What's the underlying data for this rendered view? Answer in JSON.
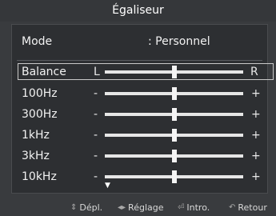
{
  "title": "Égaliseur",
  "mode": {
    "label": "Mode",
    "value": ": Personnel"
  },
  "balance": {
    "label": "Balance",
    "left": "L",
    "right": "R",
    "level": 0.5
  },
  "bands": [
    {
      "label": "100Hz",
      "minus": "-",
      "plus": "+",
      "level": 0.5
    },
    {
      "label": "300Hz",
      "minus": "-",
      "plus": "+",
      "level": 0.5
    },
    {
      "label": "1kHz",
      "minus": "-",
      "plus": "+",
      "level": 0.5
    },
    {
      "label": "3kHz",
      "minus": "-",
      "plus": "+",
      "level": 0.5
    },
    {
      "label": "10kHz",
      "minus": "-",
      "plus": "+",
      "level": 0.5
    }
  ],
  "footer": {
    "move": {
      "icon": "up-down-arrows-icon",
      "label": "Dépl."
    },
    "adjust": {
      "icon": "left-right-arrows-icon",
      "label": "Réglage"
    },
    "enter": {
      "icon": "enter-icon",
      "label": "Intro."
    },
    "back": {
      "icon": "return-icon",
      "label": "Retour"
    }
  }
}
